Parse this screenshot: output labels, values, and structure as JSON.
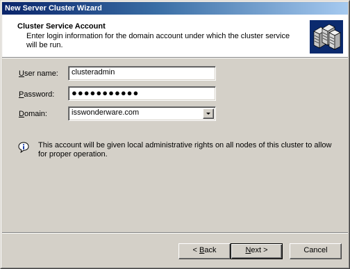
{
  "window": {
    "title": "New Server Cluster Wizard"
  },
  "header": {
    "title": "Cluster Service Account",
    "subtitle": "Enter login information for the domain account under which the cluster service will be run.",
    "icon": "server-cluster-icon"
  },
  "form": {
    "username": {
      "label_accel": "U",
      "label_rest": "ser name:",
      "value": "clusteradmin"
    },
    "password": {
      "label_accel": "P",
      "label_rest": "assword:",
      "value": "●●●●●●●●●●●"
    },
    "domain": {
      "label_accel": "D",
      "label_rest": "omain:",
      "value": "isswonderware.com"
    }
  },
  "info": {
    "icon": "info-icon",
    "text": "This account will be given local administrative rights on all nodes of this cluster to allow for proper operation."
  },
  "buttons": {
    "back_lt": "< ",
    "back_accel": "B",
    "back_rest": "ack",
    "next_accel": "N",
    "next_rest": "ext >",
    "cancel": "Cancel"
  },
  "colors": {
    "titlebar_start": "#0a246a",
    "titlebar_end": "#a6caf0",
    "face": "#d4d0c8"
  }
}
